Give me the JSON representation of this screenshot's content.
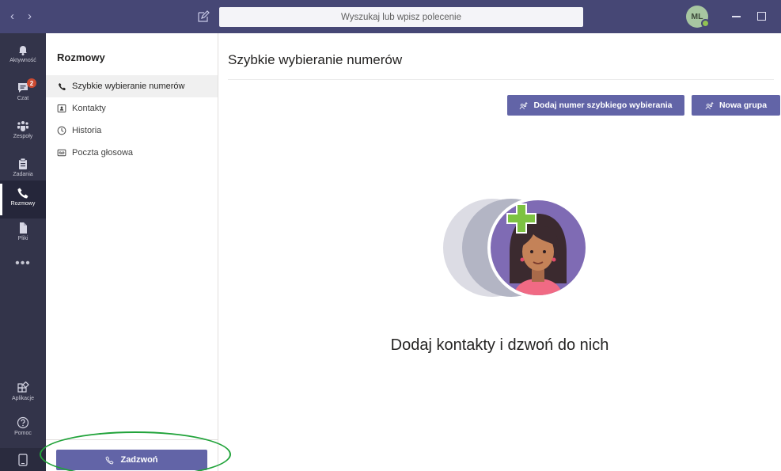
{
  "titlebar": {
    "search_placeholder": "Wyszukaj lub wpisz polecenie",
    "avatar_initials": "ML",
    "back_icon": "chevron-left-icon",
    "forward_icon": "chevron-right-icon"
  },
  "rail": {
    "items": [
      {
        "label": "Aktywność",
        "icon": "bell-icon"
      },
      {
        "label": "Czat",
        "icon": "chat-icon",
        "badge": "2"
      },
      {
        "label": "Zespoły",
        "icon": "teams-icon"
      },
      {
        "label": "Zadania",
        "icon": "tasks-icon"
      },
      {
        "label": "Rozmowy",
        "icon": "phone-icon"
      },
      {
        "label": "Pliki",
        "icon": "file-icon"
      }
    ],
    "more": "•••",
    "bottom": [
      {
        "label": "Aplikacje",
        "icon": "apps-icon"
      },
      {
        "label": "Pomoc",
        "icon": "help-icon"
      }
    ]
  },
  "leftpanel": {
    "title": "Rozmowy",
    "items": [
      {
        "label": "Szybkie wybieranie numerów",
        "icon": "phone-icon"
      },
      {
        "label": "Kontakty",
        "icon": "contact-card-icon"
      },
      {
        "label": "Historia",
        "icon": "clock-icon"
      },
      {
        "label": "Poczta głosowa",
        "icon": "voicemail-icon"
      }
    ],
    "call_button": "Zadzwoń"
  },
  "main": {
    "title": "Szybkie wybieranie numerów",
    "add_speed_dial": "Dodaj numer szybkiego wybierania",
    "new_group": "Nowa grupa",
    "empty_message": "Dodaj kontakty i dzwoń do nich"
  },
  "colors": {
    "brand": "#6264a7",
    "titlebar": "#464775",
    "rail": "#33344a",
    "annotation": "#21a33a"
  }
}
